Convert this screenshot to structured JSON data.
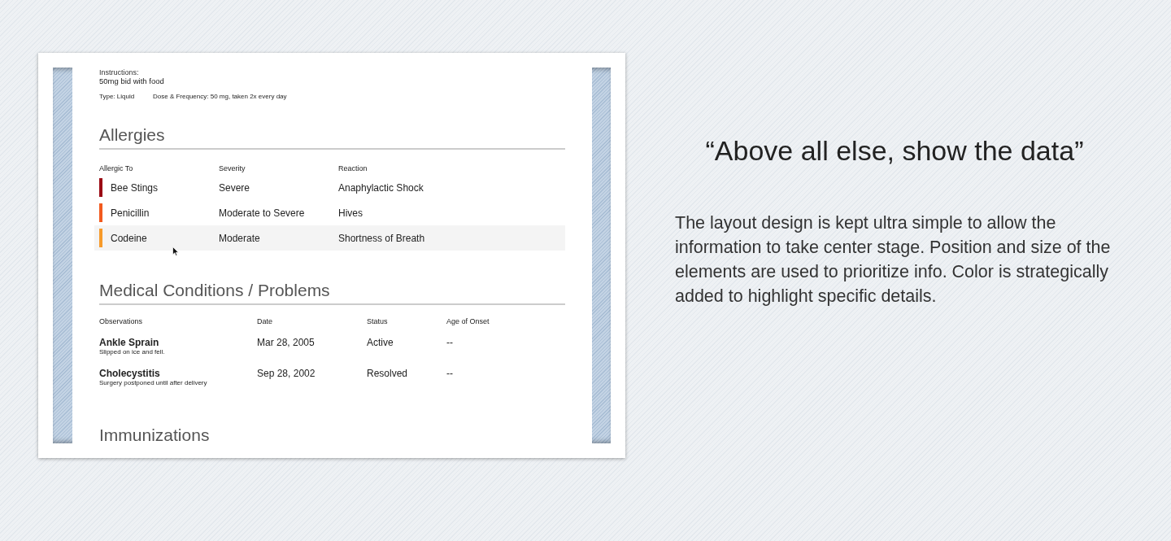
{
  "document": {
    "medication": {
      "instructions_label": "Instructions:",
      "instructions": "50mg bid with food",
      "type": "Type: Liquid",
      "dose": "Dose & Frequency: 50 mg, taken 2x every day"
    },
    "allergies": {
      "title": "Allergies",
      "columns": [
        "Allergic To",
        "Severity",
        "Reaction"
      ],
      "rows": [
        {
          "allergen": "Bee Stings",
          "severity": "Severe",
          "reaction": "Anaphylactic Shock",
          "color": "#9b0a14",
          "highlighted": false
        },
        {
          "allergen": "Penicillin",
          "severity": "Moderate to Severe",
          "reaction": "Hives",
          "color": "#f25a1e",
          "highlighted": false
        },
        {
          "allergen": "Codeine",
          "severity": "Moderate",
          "reaction": "Shortness of Breath",
          "color": "#f79a2a",
          "highlighted": true
        }
      ]
    },
    "conditions": {
      "title": "Medical Conditions / Problems",
      "columns": [
        "Observations",
        "Date",
        "Status",
        "Age of Onset"
      ],
      "rows": [
        {
          "name": "Ankle Sprain",
          "note": "Slipped on ice and fell.",
          "date": "Mar 28, 2005",
          "status": "Active",
          "onset": "--"
        },
        {
          "name": "Cholecystitis",
          "note": "Surgery postponed until after delivery",
          "date": "Sep 28, 2002",
          "status": "Resolved",
          "onset": "--"
        }
      ]
    },
    "next_section": {
      "title": "Immunizations"
    }
  },
  "quote": "“Above all else, show the data”",
  "description": "The layout design is kept ultra simple to allow the information to take center stage. Position and size of the elements are used to prioritize info. Color is strategically added to highlight specific details."
}
